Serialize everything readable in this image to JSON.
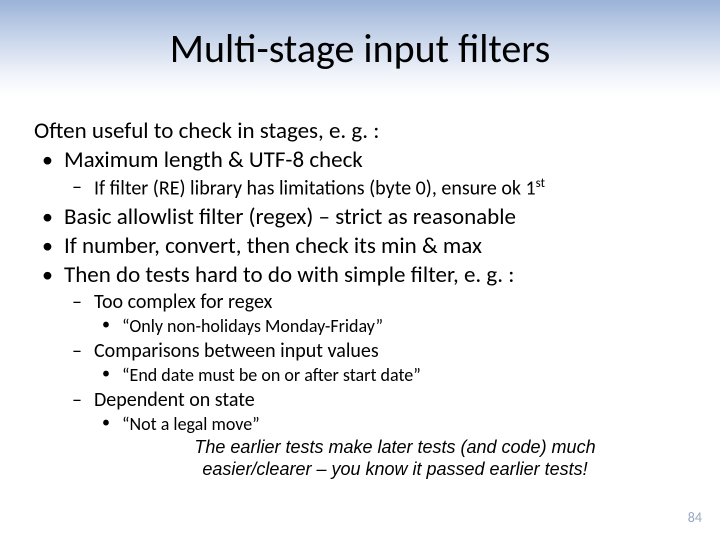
{
  "title": "Multi-stage input filters",
  "lead": "Often useful to check in stages, e. g. :",
  "bullets": {
    "b1_0": "Maximum length & UTF-8 check",
    "b2_0_pre": "If filter (RE) library has limitations (byte 0), ensure ok 1",
    "b2_0_sup": "st",
    "b1_1": "Basic allowlist filter (regex) – strict as reasonable",
    "b1_2": "If number, convert, then check its min & max",
    "b1_3": "Then do tests hard to do with simple filter, e. g. :",
    "b2_1": "Too complex for regex",
    "b3_0": "“Only non-holidays Monday-Friday”",
    "b2_2": "Comparisons between input values",
    "b3_1": "“End date must be on or after start date”",
    "b2_3": "Dependent on state",
    "b3_2": "“Not a legal move”"
  },
  "closing_l1": "The earlier tests make later tests (and code) much",
  "closing_l2": "easier/clearer – you know it passed earlier tests!",
  "page_number": "84"
}
